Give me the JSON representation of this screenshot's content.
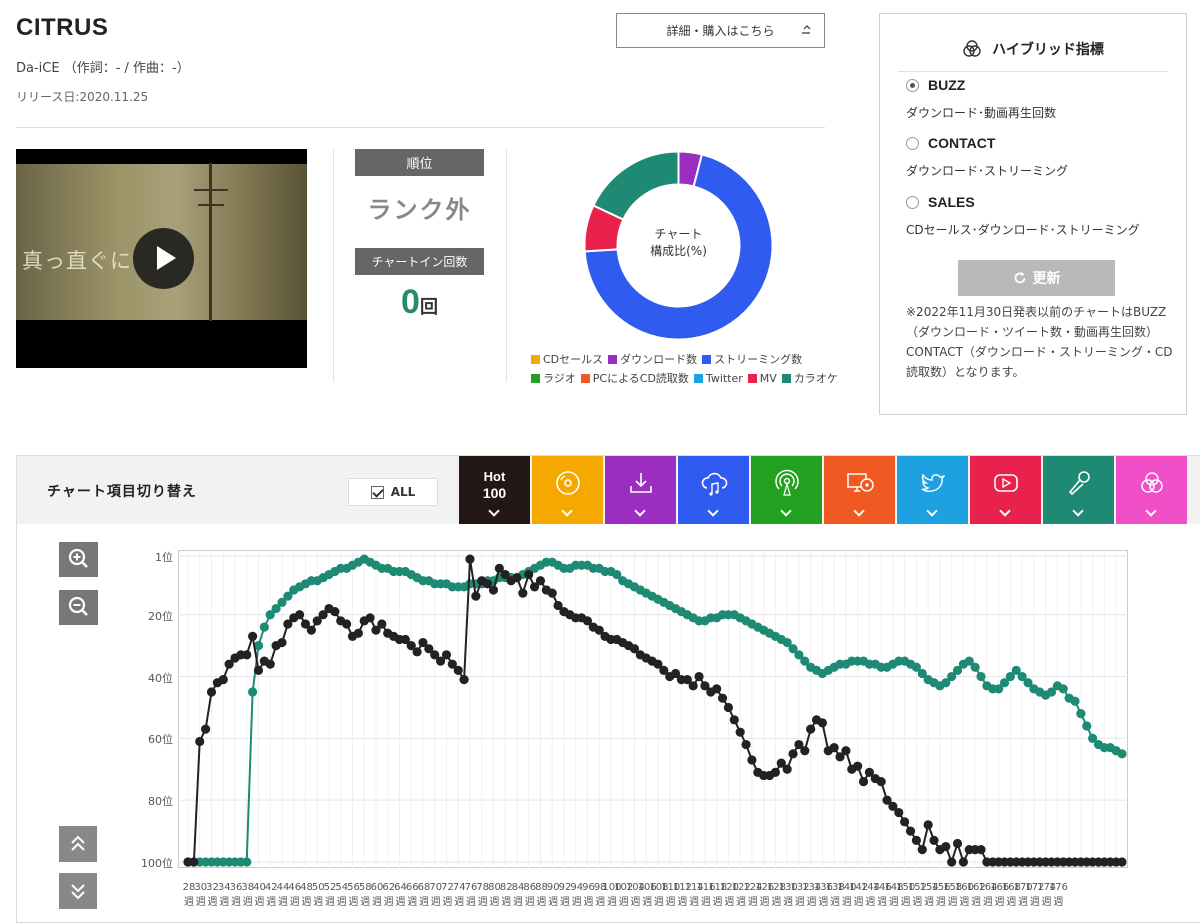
{
  "song": {
    "title": "CITRUS",
    "artist_line": "Da-iCE （作詞：- / 作曲：-）",
    "release": "リリース日:2020.11.25"
  },
  "detail_button": {
    "label": "詳細・購入はこちら",
    "icon": "external-arrow-icon"
  },
  "video": {
    "overlay_text": "真っ直ぐに"
  },
  "rank": {
    "label": "順位",
    "value": "ランク外",
    "count_label": "チャートイン回数",
    "count_value": "0",
    "count_unit": "回"
  },
  "donut": {
    "center_line1": "チャート",
    "center_line2": "構成比(%)",
    "segments": [
      {
        "name": "ダウンロード数",
        "color": "#9b2dc0",
        "pct": 4
      },
      {
        "name": "ストリーミング数",
        "color": "#2f5bf0",
        "pct": 70
      },
      {
        "name": "MV",
        "color": "#e8224d",
        "pct": 8
      },
      {
        "name": "カラオケ",
        "color": "#1e8a74",
        "pct": 18
      }
    ]
  },
  "legend": [
    {
      "label": "CDセールス",
      "color": "#f5a800"
    },
    {
      "label": "ダウンロード数",
      "color": "#9b2dc0"
    },
    {
      "label": "ストリーミング数",
      "color": "#2f5bf0"
    },
    {
      "label": "ラジオ",
      "color": "#22a020"
    },
    {
      "label": "PCによるCD読取数",
      "color": "#f05a22"
    },
    {
      "label": "Twitter",
      "color": "#1da1e0"
    },
    {
      "label": "MV",
      "color": "#e8224d"
    },
    {
      "label": "カラオケ",
      "color": "#1e8a74"
    }
  ],
  "hybrid": {
    "title": "ハイブリッド指標",
    "options": [
      {
        "label": "BUZZ",
        "desc": "ダウンロード･動画再生回数",
        "selected": true
      },
      {
        "label": "CONTACT",
        "desc": "ダウンロード･ストリーミング",
        "selected": false
      },
      {
        "label": "SALES",
        "desc": "CDセールス･ダウンロード･ストリーミング",
        "selected": false
      }
    ],
    "refresh_label": "更新",
    "note": "※2022年11月30日発表以前のチャートはBUZZ（ダウンロード・ツイート数・動画再生回数）CONTACT（ダウンロード・ストリーミング・CD読取数）となります。"
  },
  "chart_toggle": {
    "label": "チャート項目切り替え",
    "all_label": "ALL",
    "tabs": [
      {
        "name": "hot100",
        "line1": "Hot",
        "line2": "100",
        "color": "#231815"
      },
      {
        "name": "cd-sales",
        "icon": "cd-icon",
        "color": "#f5a800"
      },
      {
        "name": "download",
        "icon": "download-icon",
        "color": "#9b2dc0"
      },
      {
        "name": "streaming",
        "icon": "cloud-music-icon",
        "color": "#2f5bf0"
      },
      {
        "name": "radio",
        "icon": "radio-icon",
        "color": "#22a020"
      },
      {
        "name": "pc-cd",
        "icon": "pc-cd-icon",
        "color": "#f05a22"
      },
      {
        "name": "twitter",
        "icon": "twitter-icon",
        "color": "#1da1e0"
      },
      {
        "name": "mv",
        "icon": "youtube-icon",
        "color": "#e8224d"
      },
      {
        "name": "karaoke",
        "icon": "microphone-icon",
        "color": "#1e8a74"
      },
      {
        "name": "hybrid",
        "icon": "hybrid-icon",
        "color": "#f04fc8"
      }
    ]
  },
  "chart_data": {
    "type": "line",
    "y_axis": {
      "inverted": true,
      "ticks": [
        {
          "label": "1位",
          "value": 1
        },
        {
          "label": "20位",
          "value": 20
        },
        {
          "label": "40位",
          "value": 40
        },
        {
          "label": "60位",
          "value": 60
        },
        {
          "label": "80位",
          "value": 80
        },
        {
          "label": "100位",
          "value": 100
        }
      ],
      "ylim": [
        1,
        100
      ]
    },
    "x_week_labels": [
      "28週",
      "30週",
      "32週",
      "34週",
      "36週",
      "38週",
      "40週",
      "42週",
      "44週",
      "46週",
      "48週",
      "50週",
      "52週",
      "54週",
      "56週",
      "58週",
      "60週",
      "62週",
      "64週",
      "66週",
      "68週",
      "70週",
      "72週",
      "74週",
      "76週",
      "78週",
      "80週",
      "82週",
      "84週",
      "86週",
      "88週",
      "90週",
      "92週",
      "94週",
      "96週",
      "98週",
      "100週",
      "102週",
      "104週",
      "106週",
      "108週",
      "110週",
      "112週",
      "114週",
      "116週",
      "118週",
      "120週",
      "122週",
      "124週",
      "126週",
      "128週",
      "130週",
      "132週",
      "134週",
      "136週",
      "138週",
      "140週",
      "142週",
      "144週",
      "146週",
      "148週",
      "150週",
      "152週",
      "154週",
      "156週",
      "158週",
      "160週",
      "162週",
      "164週",
      "166週",
      "168週",
      "170週",
      "172週",
      "174週",
      "176週"
    ],
    "series": [
      {
        "key": "karaoke",
        "color": "#1e8a74",
        "start": 0,
        "values": [
          100,
          100,
          100,
          100,
          100,
          100,
          100,
          100,
          100,
          100,
          100,
          45,
          30,
          24,
          20,
          18,
          16,
          14,
          12,
          11,
          10,
          9,
          9,
          8,
          7,
          6,
          5,
          5,
          4,
          3,
          2,
          3,
          4,
          5,
          5,
          6,
          6,
          6,
          7,
          8,
          9,
          9,
          10,
          10,
          10,
          11,
          11,
          11,
          10,
          10,
          10,
          9,
          9,
          8,
          8,
          8,
          8,
          7,
          6,
          5,
          4,
          3,
          3,
          4,
          5,
          5,
          4,
          4,
          4,
          5,
          5,
          6,
          6,
          7,
          9,
          10,
          11,
          12,
          13,
          14,
          15,
          16,
          17,
          18,
          19,
          20,
          21,
          22,
          22,
          21,
          21,
          20,
          20,
          20,
          21,
          22,
          23,
          24,
          25,
          26,
          27,
          28,
          29,
          31,
          33,
          35,
          37,
          38,
          39,
          38,
          37,
          36,
          36,
          35,
          35,
          35,
          36,
          36,
          37,
          37,
          36,
          35,
          35,
          36,
          37,
          39,
          41,
          42,
          43,
          42,
          40,
          38,
          36,
          35,
          37,
          40,
          43,
          44,
          44,
          42,
          40,
          38,
          40,
          42,
          44,
          45,
          46,
          45,
          43,
          44,
          47,
          48,
          52,
          56,
          60,
          62,
          63,
          63,
          64,
          65
        ]
      },
      {
        "key": "hot100",
        "color": "#222222",
        "start": 0,
        "values": [
          100,
          100,
          61,
          57,
          45,
          42,
          41,
          36,
          34,
          33,
          33,
          27,
          38,
          35,
          36,
          30,
          29,
          23,
          21,
          20,
          23,
          25,
          22,
          20,
          18,
          19,
          22,
          23,
          27,
          26,
          22,
          21,
          25,
          23,
          26,
          27,
          28,
          28,
          30,
          32,
          29,
          31,
          33,
          35,
          33,
          36,
          38,
          41,
          2,
          14,
          9,
          10,
          12,
          5,
          7,
          9,
          8,
          13,
          7,
          11,
          9,
          12,
          13,
          17,
          19,
          20,
          21,
          21,
          22,
          24,
          25,
          27,
          28,
          28,
          29,
          30,
          31,
          33,
          34,
          35,
          36,
          38,
          40,
          39,
          41,
          41,
          43,
          40,
          43,
          45,
          44,
          47,
          50,
          54,
          58,
          62,
          67,
          71,
          72,
          72,
          71,
          68,
          70,
          65,
          62,
          64,
          57,
          54,
          55,
          64,
          63,
          66,
          64,
          70,
          69,
          74,
          71,
          73,
          74,
          80,
          82,
          84,
          87,
          90,
          93,
          96,
          88,
          93,
          96,
          95,
          100,
          94,
          100,
          96,
          96,
          96,
          100,
          100,
          100,
          100,
          100,
          100,
          100,
          100,
          100,
          100,
          100,
          100,
          100,
          100,
          100,
          100,
          100,
          100,
          100,
          100,
          100,
          100,
          100,
          100
        ]
      }
    ]
  }
}
